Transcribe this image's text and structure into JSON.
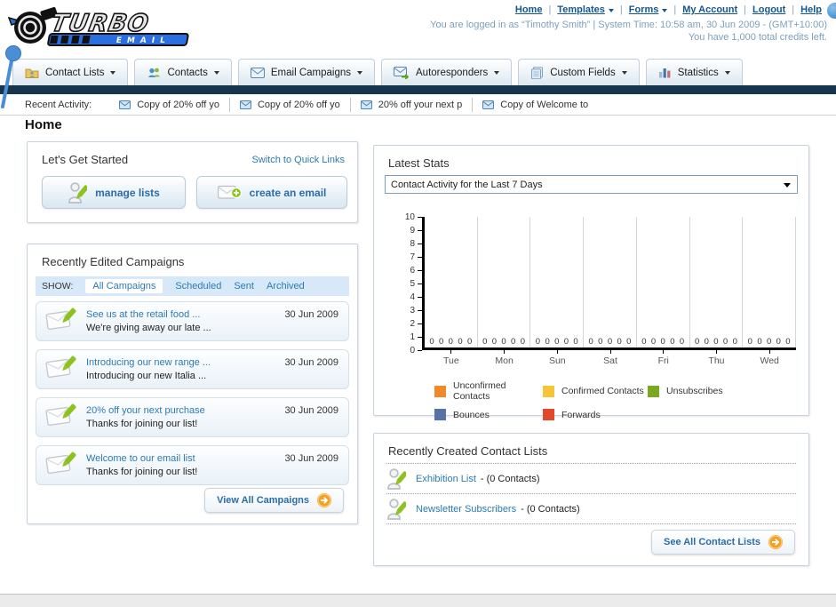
{
  "logo": {
    "title": "TURBO",
    "subtitle": "EMAIL"
  },
  "top_nav": {
    "links": [
      {
        "label": "Home",
        "caret": false
      },
      {
        "label": "Templates",
        "caret": true
      },
      {
        "label": "Forms",
        "caret": true
      },
      {
        "label": "My Account",
        "caret": false
      },
      {
        "label": "Logout",
        "caret": false
      },
      {
        "label": "Help",
        "caret": false
      }
    ],
    "login_line1": "You are logged in as “Timothy Smith” | System Time: 10:58 am, 30 Jun 2009 - (GMT+10:00)",
    "login_line2": "You have 1,000 total credits left."
  },
  "main_tabs": [
    {
      "label": "Contact Lists",
      "icon": "contact-lists"
    },
    {
      "label": "Contacts",
      "icon": "contacts"
    },
    {
      "label": "Email Campaigns",
      "icon": "email-campaigns"
    },
    {
      "label": "Autoresponders",
      "icon": "autoresponders"
    },
    {
      "label": "Custom Fields",
      "icon": "custom-fields"
    },
    {
      "label": "Statistics",
      "icon": "statistics"
    }
  ],
  "recent_activity": {
    "label": "Recent Activity:",
    "items": [
      {
        "text": "Copy of 20% off yo"
      },
      {
        "text": "Copy of 20% off yo"
      },
      {
        "text": "20% off your next p"
      },
      {
        "text": "Copy of Welcome to"
      }
    ]
  },
  "page_title": "Home",
  "get_started": {
    "title": "Let's Get Started",
    "switch_link": "Switch to Quick Links",
    "buttons": [
      {
        "label": "manage lists",
        "icon": "pencil-user"
      },
      {
        "label": "create an email",
        "icon": "envelope-plus"
      }
    ]
  },
  "campaigns": {
    "title": "Recently Edited Campaigns",
    "show_label": "SHOW:",
    "filters": [
      {
        "label": "All Campaigns",
        "active": true
      },
      {
        "label": "Scheduled",
        "active": false
      },
      {
        "label": "Sent",
        "active": false
      },
      {
        "label": "Archived",
        "active": false
      }
    ],
    "items": [
      {
        "title": "See us at the retail food ...",
        "subtitle": "We're giving away our late ...",
        "date": "30 Jun 2009"
      },
      {
        "title": "Introducing our new range ...",
        "subtitle": "Introducing our new Italia ...",
        "date": "30 Jun 2009"
      },
      {
        "title": "20% off your next purchase",
        "subtitle": "Thanks for joining our list!",
        "date": "30 Jun 2009"
      },
      {
        "title": "Welcome to our email list",
        "subtitle": "Thanks for joining our list!",
        "date": "30 Jun 2009"
      }
    ],
    "view_all_label": "View All Campaigns"
  },
  "stats": {
    "title": "Latest Stats",
    "selector_value": "Contact Activity for the Last 7 Days",
    "chart_data": {
      "type": "bar",
      "title": "Contact Activity for the Last 7 Days",
      "categories": [
        "Tue",
        "Mon",
        "Sun",
        "Sat",
        "Fri",
        "Thu",
        "Wed"
      ],
      "series": [
        {
          "name": "Unconfirmed Contacts",
          "color": "#F0882C",
          "values": [
            0,
            0,
            0,
            0,
            0,
            0,
            0
          ]
        },
        {
          "name": "Confirmed Contacts",
          "color": "#F6C436",
          "values": [
            0,
            0,
            0,
            0,
            0,
            0,
            0
          ]
        },
        {
          "name": "Unsubscribes",
          "color": "#7BA821",
          "values": [
            0,
            0,
            0,
            0,
            0,
            0,
            0
          ]
        },
        {
          "name": "Bounces",
          "color": "#5673A7",
          "values": [
            0,
            0,
            0,
            0,
            0,
            0,
            0
          ]
        },
        {
          "name": "Forwards",
          "color": "#E2492B",
          "values": [
            0,
            0,
            0,
            0,
            0,
            0,
            0
          ]
        }
      ],
      "ylim": [
        0,
        10
      ],
      "yticks": [
        0,
        1,
        2,
        3,
        4,
        5,
        6,
        7,
        8,
        9,
        10
      ],
      "grid": true,
      "legend_position": "bottom"
    }
  },
  "contact_lists": {
    "title": "Recently Created Contact Lists",
    "items": [
      {
        "name": "Exhibition List",
        "detail": "- (0 Contacts)"
      },
      {
        "name": "Newsletter Subscribers",
        "detail": "- (0 Contacts)"
      }
    ],
    "see_all_label": "See All Contact Lists"
  }
}
